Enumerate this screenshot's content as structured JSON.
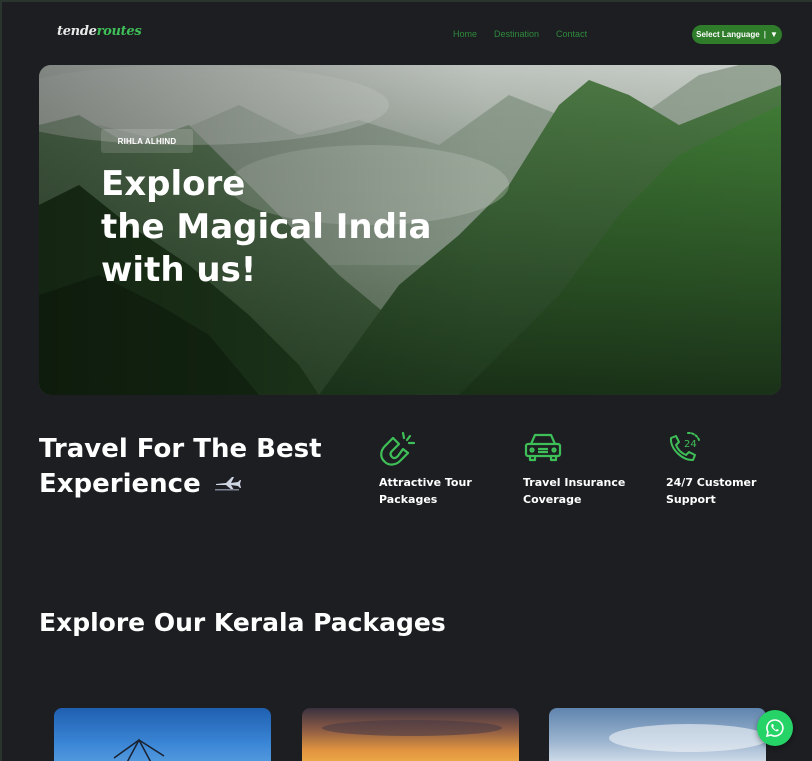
{
  "nav": {
    "logo_part1": "tende",
    "logo_part2": "routes",
    "menu": [
      "Home",
      "Destination",
      "Contact"
    ],
    "language_label": "Select Language",
    "language_caret": "▼"
  },
  "hero": {
    "badge": "RIHLA ALHIND",
    "title_lines": [
      "Explore",
      "the Magical India",
      "with us!"
    ]
  },
  "experience": {
    "title_lines": [
      "Travel For The Best",
      "Experience"
    ],
    "plane_icon": "airplane-icon",
    "features": [
      {
        "icon": "magnet-icon",
        "lines": [
          "Attractive Tour",
          "Packages"
        ]
      },
      {
        "icon": "car-icon",
        "lines": [
          "Travel Insurance",
          "Coverage"
        ]
      },
      {
        "icon": "support-24-phone-icon",
        "lines": [
          "24/7 Customer",
          "Support"
        ]
      }
    ]
  },
  "packages": {
    "title": "Explore Our Kerala Packages"
  },
  "colors": {
    "background": "#1d1e22",
    "accent_green": "#3fbf57",
    "nav_link": "#2e8a3c",
    "language_button": "#2f7d2a",
    "whatsapp": "#25d366"
  },
  "floating": {
    "whatsapp_icon": "whatsapp-icon"
  }
}
